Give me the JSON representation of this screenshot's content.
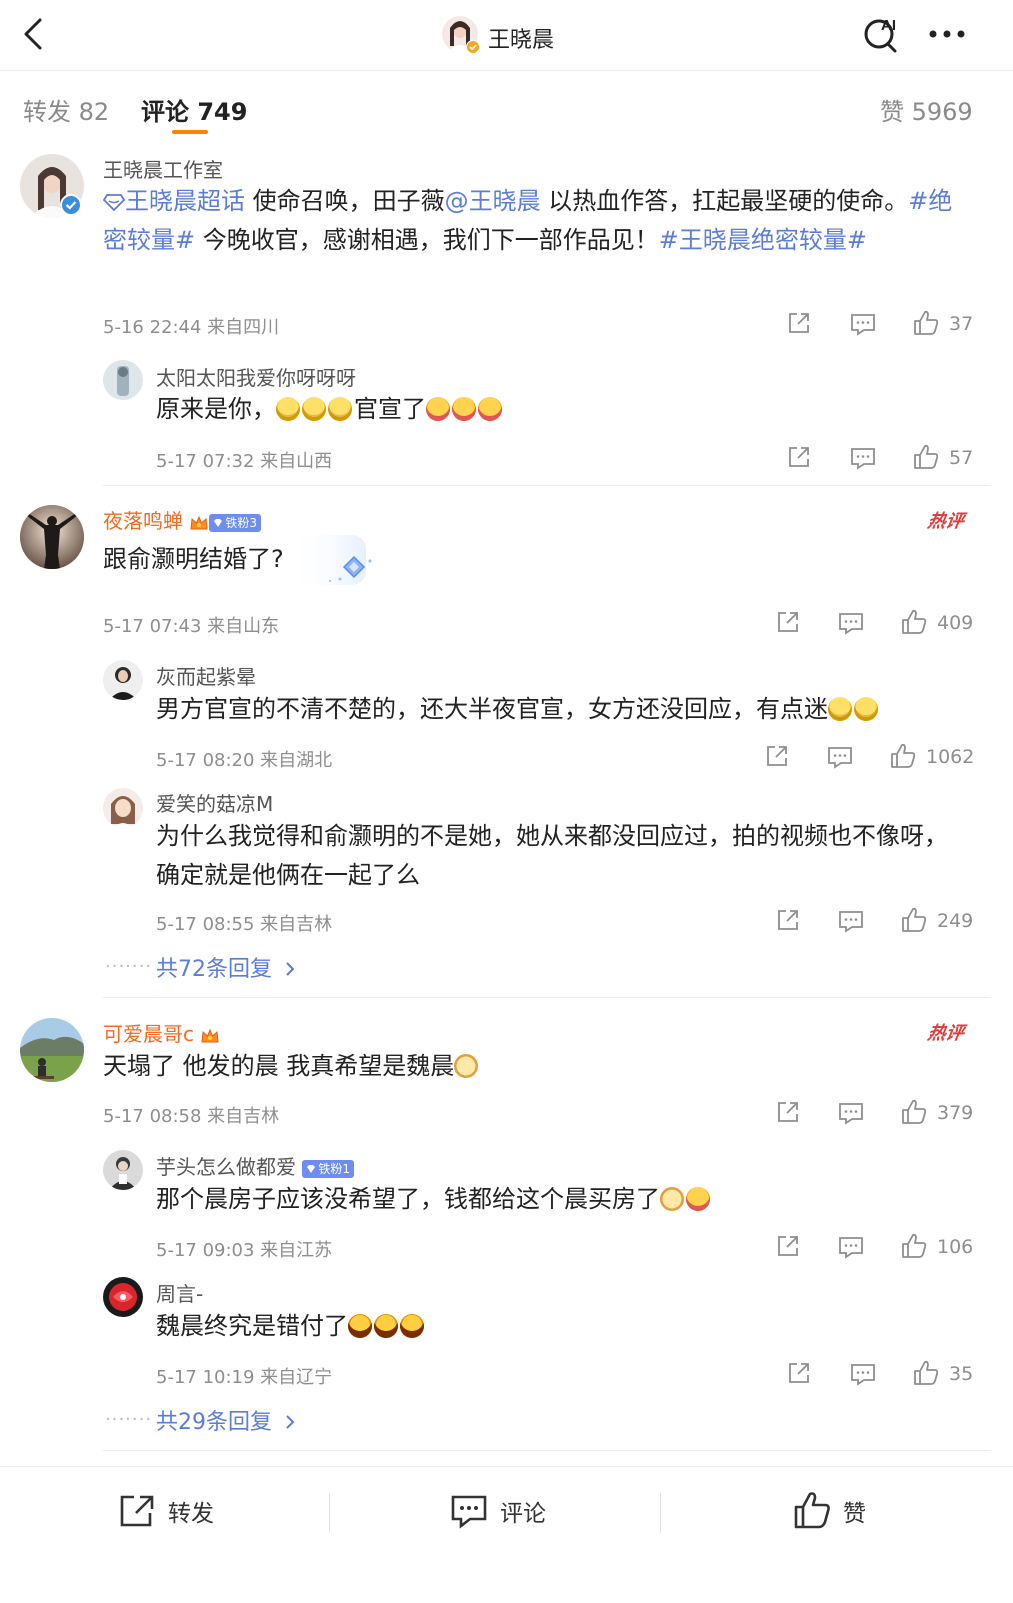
{
  "header": {
    "title": "王晓晨"
  },
  "tabs": {
    "repost": "转发 82",
    "comment": "评论 749",
    "likes": "赞 5969"
  },
  "comments": [
    {
      "user": "王晓晨工作室",
      "text": {
        "supertopic": "王晓晨超话",
        "t1": " 使命召唤，田子薇",
        "mention": "@王晓晨",
        "t2": " 以热血作答，扛起最坚硬的使命。",
        "tag1": "#绝密较量#",
        "t3": " 今晚收官，感谢相遇，我们下一部作品见！",
        "tag2": "#王晓晨绝密较量#"
      },
      "meta": "5-16 22:44  来自四川",
      "likes": "37"
    },
    {
      "user": "太阳太阳我爱你呀呀呀",
      "text": {
        "t1": "原来是你，",
        "t2": "官宣了"
      },
      "meta": "5-17 07:32  来自山西",
      "likes": "57"
    },
    {
      "user": "夜落鸣蝉",
      "badge": "铁粉3",
      "hot": "热评",
      "text": "跟俞灏明结婚了?",
      "meta": "5-17 07:43  来自山东",
      "likes": "409"
    },
    {
      "user": "灰而起紫晕",
      "text": "男方官宣的不清不楚的，还大半夜官宣，女方还没回应，有点迷",
      "meta": "5-17 08:20  来自湖北",
      "likes": "1062"
    },
    {
      "user": "爱笑的菇凉M",
      "text": "为什么我觉得和俞灏明的不是她，她从来都没回应过，拍的视频也不像呀，确定就是他俩在一起了么",
      "meta": "5-17 08:55  来自吉林",
      "likes": "249"
    },
    {
      "user": "可爱晨哥c",
      "hot": "热评",
      "text": "天塌了 他发的晨 我真希望是魏晨",
      "meta": "5-17 08:58  来自吉林",
      "likes": "379"
    },
    {
      "user": "芋头怎么做都爱",
      "badge": "铁粉1",
      "text": "那个晨房子应该没希望了，钱都给这个晨买房了",
      "meta": "5-17 09:03  来自江苏",
      "likes": "106"
    },
    {
      "user": "周言-",
      "text": "魏晨终究是错付了",
      "meta": "5-17 10:19  来自辽宁",
      "likes": "35"
    }
  ],
  "more_replies": [
    "共72条回复",
    "共29条回复"
  ],
  "bottombar": {
    "repost": "转发",
    "comment": "评论",
    "like": "赞"
  },
  "colors": {
    "accent": "#ff8200",
    "link": "#5b7dd6",
    "vip_name": "#f36a21",
    "hot": "#e33a3a"
  }
}
